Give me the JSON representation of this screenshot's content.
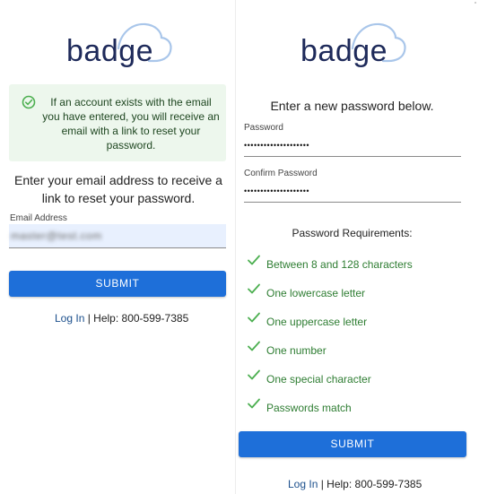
{
  "brand": {
    "logo_text": "badge",
    "primary_color": "#1e6fd9",
    "logo_color": "#1e2a5a",
    "success_color": "#2e7d32"
  },
  "forgot_password": {
    "alert": {
      "icon": "check-circle-icon",
      "text": "If an account exists with the email you have entered, you will receive an email with a link to reset your password."
    },
    "instructions": "Enter your email address to receive a link to reset your password.",
    "email": {
      "label": "Email Address",
      "value": "master@test.com"
    },
    "submit_label": "SUBMIT",
    "footer": {
      "login_label": "Log In",
      "separator": " | ",
      "help_text": "Help: 800-599-7385"
    }
  },
  "reset_password": {
    "instructions": "Enter a new password below.",
    "password": {
      "label": "Password",
      "value": "••••••••••••••••••••"
    },
    "confirm_password": {
      "label": "Confirm Password",
      "value": "••••••••••••••••••••"
    },
    "requirements_heading": "Password Requirements:",
    "requirements": [
      {
        "icon": "check-icon",
        "label": "Between 8 and 128 characters"
      },
      {
        "icon": "check-icon",
        "label": "One lowercase letter"
      },
      {
        "icon": "check-icon",
        "label": "One uppercase letter"
      },
      {
        "icon": "check-icon",
        "label": "One number"
      },
      {
        "icon": "check-icon",
        "label": "One special character"
      },
      {
        "icon": "check-icon",
        "label": "Passwords match"
      }
    ],
    "submit_label": "SUBMIT",
    "footer": {
      "login_label": "Log In",
      "separator": " | ",
      "help_text": "Help: 800-599-7385"
    }
  }
}
